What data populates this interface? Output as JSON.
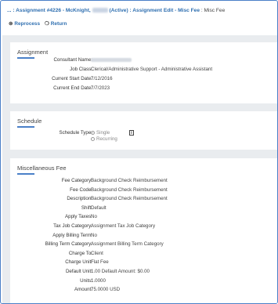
{
  "breadcrumb": {
    "prefix": "... :",
    "assignment": "Assignment #4226 - McKnight,",
    "status": "(Active)",
    "edit": ": Assignment Edit - Misc Fee",
    "current": ": Misc Fee"
  },
  "actions": {
    "reprocess_label": "Reprocess",
    "reprocess_icon": "refresh-icon",
    "return_label": "Return",
    "return_icon": "return-icon"
  },
  "assignment": {
    "title": "Assignment",
    "fields": [
      {
        "label": "Consultant Name:",
        "value": ""
      },
      {
        "label": "Job Class:",
        "value": "Clerical/Administrative Support - Administrative Assistant"
      },
      {
        "label": "Current Start Date:",
        "value": "7/12/2016"
      },
      {
        "label": "Current End Date:",
        "value": "7/7/2023"
      }
    ]
  },
  "schedule": {
    "title": "Schedule",
    "type_label": "Schedule Type:",
    "options": [
      "Single",
      "Recurring"
    ],
    "selected": "Single",
    "info_icon": "info-icon"
  },
  "misc_fee": {
    "title": "Miscellaneous Fee",
    "fields": [
      {
        "label": "Fee Category:",
        "value": "Background Check Reimbursement"
      },
      {
        "label": "Fee Code:",
        "value": "Background Check Reimbursement"
      },
      {
        "label": "Description:",
        "value": "Background Check Reimbursement"
      },
      {
        "label": "Shift:",
        "value": "Default"
      },
      {
        "label": "Apply Taxes:",
        "value": "No"
      },
      {
        "label": "Tax Job Category:",
        "value": "Assignment Tax Job Category"
      },
      {
        "label": "Apply Billing Term:",
        "value": "No"
      },
      {
        "label": "Billing Term Category:",
        "value": "Assignment Billing Term Category"
      },
      {
        "label": "Charge To:",
        "value": "Client"
      },
      {
        "label": "Charge Unit:",
        "value": "Flat Fee"
      },
      {
        "label": "Default Unit:",
        "value": "1.00   Default Amount: $0.00"
      },
      {
        "label": "Units:",
        "value": "1.0000"
      },
      {
        "label": "Amount:",
        "value": "75.0000 USD"
      }
    ]
  },
  "colors": {
    "accent": "#2f6fb0",
    "frame": "#4a80c8",
    "background": "#e9ecef"
  }
}
